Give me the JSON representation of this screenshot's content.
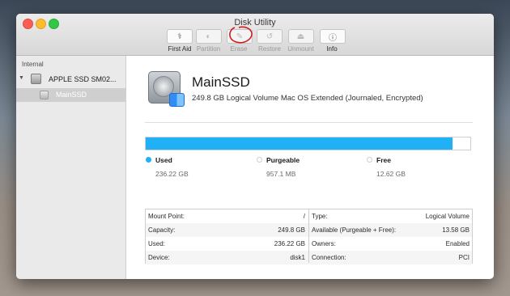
{
  "window": {
    "title": "Disk Utility"
  },
  "toolbar": [
    {
      "label": "First Aid",
      "icon": "stethoscope-icon",
      "enabled": true
    },
    {
      "label": "Partition",
      "icon": "partition-icon",
      "enabled": false
    },
    {
      "label": "Erase",
      "icon": "erase-icon",
      "enabled": false
    },
    {
      "label": "Restore",
      "icon": "restore-icon",
      "enabled": false
    },
    {
      "label": "Unmount",
      "icon": "unmount-icon",
      "enabled": false
    },
    {
      "label": "Info",
      "icon": "info-icon",
      "enabled": true
    }
  ],
  "sidebar": {
    "header": "Internal",
    "disk": {
      "name": "APPLE SSD SM02..."
    },
    "volume": {
      "name": "MainSSD"
    }
  },
  "volume": {
    "name": "MainSSD",
    "description": "249.8 GB Logical Volume Mac OS Extended (Journaled, Encrypted)"
  },
  "usage": {
    "used_fraction": 0.945,
    "accent_color": "#1fb0f5",
    "legend": [
      {
        "name": "Used",
        "amount": "236.22 GB",
        "color": "#1fb0f5"
      },
      {
        "name": "Purgeable",
        "amount": "957.1 MB",
        "color": "#ffffff"
      },
      {
        "name": "Free",
        "amount": "12.62 GB",
        "color": "#ffffff"
      }
    ]
  },
  "info_table": {
    "left": [
      {
        "label": "Mount Point:",
        "value": "/"
      },
      {
        "label": "Capacity:",
        "value": "249.8 GB"
      },
      {
        "label": "Used:",
        "value": "236.22 GB"
      },
      {
        "label": "Device:",
        "value": "disk1"
      }
    ],
    "right": [
      {
        "label": "Type:",
        "value": "Logical Volume"
      },
      {
        "label": "Available (Purgeable + Free):",
        "value": "13.58 GB"
      },
      {
        "label": "Owners:",
        "value": "Enabled"
      },
      {
        "label": "Connection:",
        "value": "PCI"
      }
    ]
  }
}
